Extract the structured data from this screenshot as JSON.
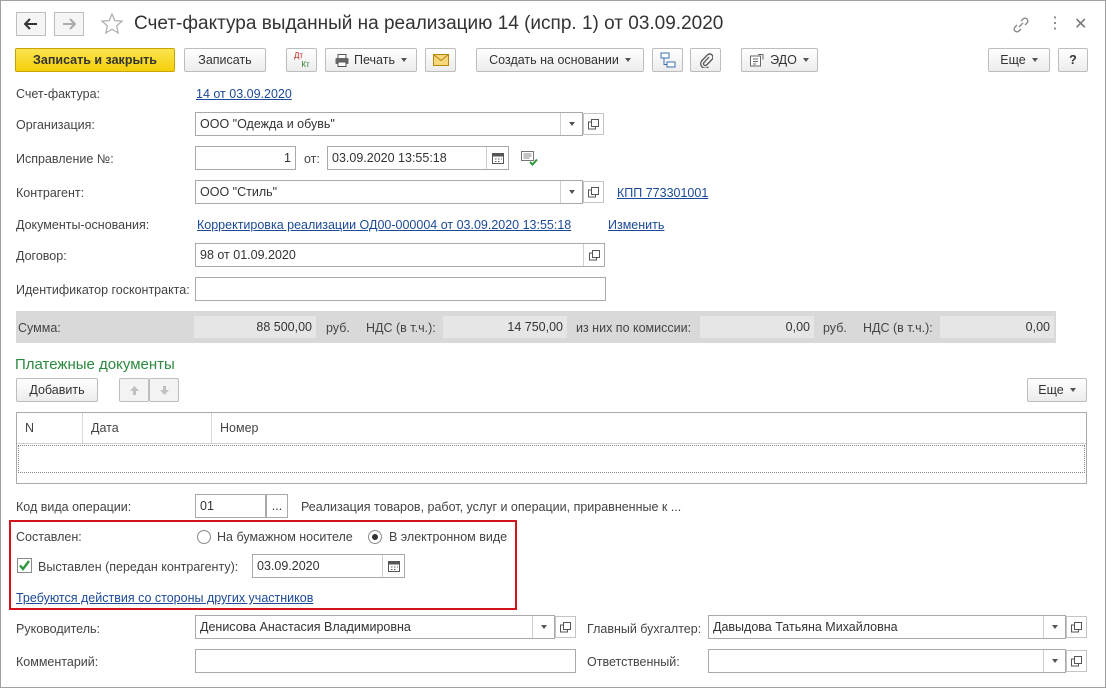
{
  "title": "Счет-фактура выданный на реализацию 14 (испр. 1) от 03.09.2020",
  "toolbar": {
    "save_close": "Записать и закрыть",
    "save": "Записать",
    "dtkt_top": "Дт",
    "dtkt_bottom": "Кт",
    "print": "Печать",
    "create_based": "Создать на основании",
    "edo": "ЭДО",
    "more": "Еще",
    "help": "?"
  },
  "form": {
    "invoice_label": "Счет-фактура:",
    "invoice_link": "14 от 03.09.2020",
    "org_label": "Организация:",
    "org_value": "ООО \"Одежда и обувь\"",
    "fix_label": "Исправление №:",
    "fix_number": "1",
    "from_label": "от:",
    "fix_date": "03.09.2020 13:55:18",
    "counterparty_label": "Контрагент:",
    "counterparty_value": "ООО \"Стиль\"",
    "kpp_link": "КПП 773301001",
    "base_docs_label": "Документы-основания:",
    "base_docs_link": "Корректировка реализации ОД00-000004 от 03.09.2020 13:55:18",
    "change_link": "Изменить",
    "contract_label": "Договор:",
    "contract_value": "98 от 01.09.2020",
    "gov_contract_label": "Идентификатор госконтракта:",
    "gov_contract_value": ""
  },
  "sums": {
    "sum_label": "Сумма:",
    "sum_value": "88 500,00",
    "currency1": "руб.",
    "vat_label": "НДС (в т.ч.):",
    "vat_value": "14 750,00",
    "commission_label": "из них по комиссии:",
    "commission_value": "0,00",
    "currency2": "руб.",
    "vat2_label": "НДС (в т.ч.):",
    "vat2_value": "0,00"
  },
  "payments": {
    "section_title": "Платежные документы",
    "add_button": "Добавить",
    "more_button": "Еще",
    "columns": [
      "N",
      "Дата",
      "Номер"
    ]
  },
  "operation": {
    "code_label": "Код вида операции:",
    "code_value": "01",
    "code_select": "...",
    "code_description": "Реализация товаров, работ, услуг и операции, приравненные к ..."
  },
  "composed": {
    "label": "Составлен:",
    "option_paper": "На бумажном носителе",
    "option_electronic": "В электронном виде",
    "selected": "electronic",
    "issued_label": "Выставлен (передан контрагенту):",
    "issued_checked": true,
    "issued_date": "03.09.2020",
    "action_link": "Требуются действия со стороны других участников"
  },
  "signers": {
    "head_label": "Руководитель:",
    "head_value": "Денисова Анастасия Владимировна",
    "accountant_label": "Главный бухгалтер:",
    "accountant_value": "Давыдова Татьяна Михайловна",
    "comment_label": "Комментарий:",
    "comment_value": "",
    "responsible_label": "Ответственный:",
    "responsible_value": ""
  },
  "colors": {
    "accent_yellow": "#f4cf0a",
    "link_blue": "#1c4a99",
    "section_green": "#2a8a3e",
    "highlight_red": "#d3121b"
  }
}
